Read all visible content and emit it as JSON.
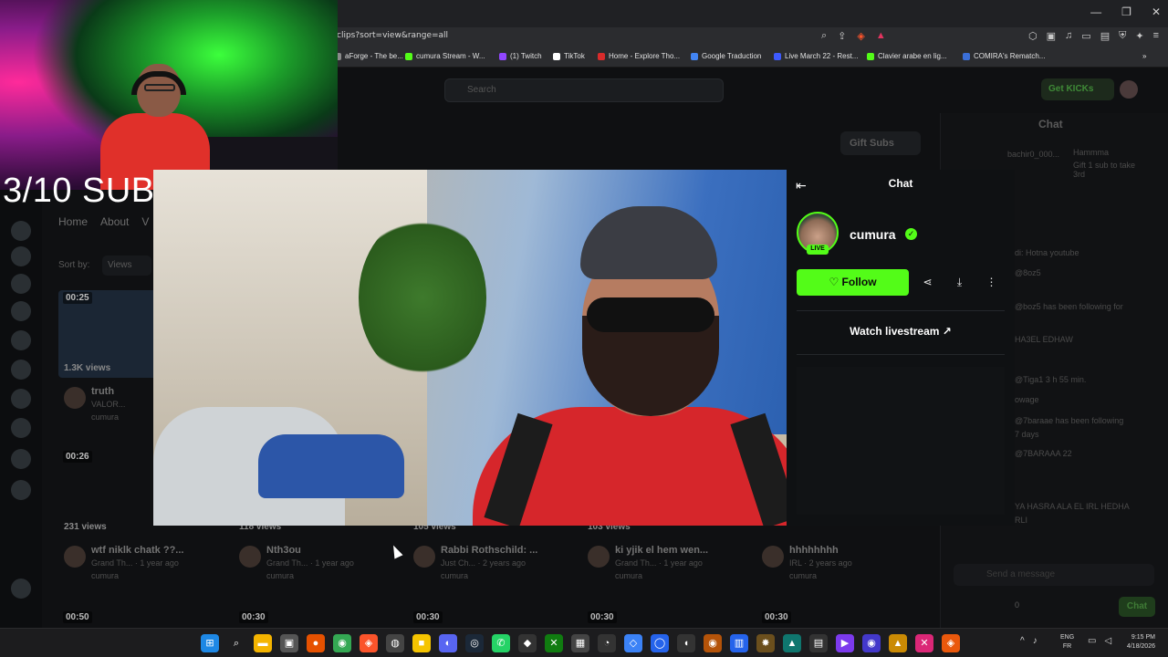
{
  "browser": {
    "url": "clips?sort=view&range=all",
    "window_controls": [
      "—",
      "❐",
      "✕"
    ],
    "bookmarks": [
      {
        "label": "aForge - The be...",
        "color": "#8a8a8a"
      },
      {
        "label": "cumura Stream - W...",
        "color": "#53fc18"
      },
      {
        "label": "(1) Twitch",
        "color": "#9146ff"
      },
      {
        "label": "TikTok",
        "color": "#ffffff"
      },
      {
        "label": "Home - Explore Tho...",
        "color": "#d82b2b"
      },
      {
        "label": "Google Traduction",
        "color": "#4285f4"
      },
      {
        "label": "Live March 22 - Rest...",
        "color": "#3d5afe"
      },
      {
        "label": "Clavier arabe en lig...",
        "color": "#53fc18"
      },
      {
        "label": "COMIRA's Rematch...",
        "color": "#3b6fd8"
      }
    ]
  },
  "overlay": {
    "sub_counter": "3/10 SUB"
  },
  "kick_page": {
    "search_placeholder": "Search",
    "get_kicks": "Get KICKs",
    "gift_subs": "Gift Subs",
    "tabs": [
      "Home",
      "About",
      "V"
    ],
    "sort_by_label": "Sort by:",
    "sort_value": "Views",
    "chat_title": "Chat",
    "chat_input_placeholder": "Send a message",
    "chat_send": "Chat",
    "chat_count": "0",
    "chat_lines": [
      "bachir0_000...",
      "Hammma",
      "Gift 1 sub to take",
      "3rd",
      "di: Hotna youtube",
      "@8oz5",
      "@boz5 has been following for",
      "HA3EL EDHAW",
      "@Tiga1 3 h 55 min.",
      "owage",
      "@7baraae has been following",
      "7 days",
      "@7BARAAA 22",
      "YA HASRA ALA EL IRL HEDHA",
      "RLI"
    ],
    "clips": [
      {
        "duration": "00:25",
        "views": "1.3K views",
        "title": "truth",
        "sub1": "VALOR...",
        "sub2": "cumura"
      },
      {
        "duration": "00:26",
        "views": "231 views",
        "title": "wtf niklk chatk ??...",
        "sub1": "Grand Th... · 1 year ago",
        "sub2": "cumura"
      },
      {
        "duration": "",
        "views": "118 views",
        "title": "Nth3ou",
        "sub1": "Grand Th... · 1 year ago",
        "sub2": "cumura"
      },
      {
        "duration": "",
        "views": "105 views",
        "title": "Rabbi Rothschild: ...",
        "sub1": "Just Ch... · 2 years ago",
        "sub2": "cumura"
      },
      {
        "duration": "",
        "views": "103 views",
        "title": "ki yjik el hem wen...",
        "sub1": "Grand Th... · 1 year ago",
        "sub2": "cumura"
      },
      {
        "duration": "",
        "views": "",
        "title": "hhhhhhhh",
        "sub1": "IRL · 2 years ago",
        "sub2": "cumura"
      }
    ],
    "bottom_durations": [
      "00:50",
      "00:30",
      "00:30",
      "00:30",
      "00:30"
    ]
  },
  "clip_modal": {
    "panel_title": "Chat",
    "channel_name": "cumura",
    "live_badge": "LIVE",
    "follow_label": "Follow",
    "watch_livestream": "Watch livestream"
  },
  "taskbar": {
    "lang_line1": "ENG",
    "lang_line2": "FR",
    "time": "9:15 PM",
    "date": "4/18/2026"
  }
}
